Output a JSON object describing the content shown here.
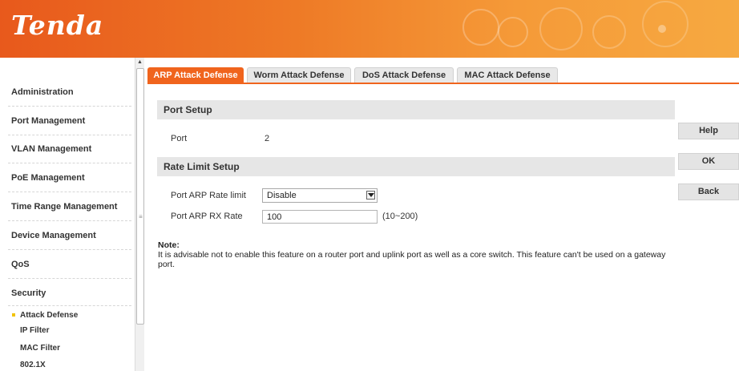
{
  "header": {
    "logo": "Tenda"
  },
  "sidebar": {
    "items": [
      {
        "label": "Administration"
      },
      {
        "label": "Port Management"
      },
      {
        "label": "VLAN Management"
      },
      {
        "label": "PoE Management"
      },
      {
        "label": "Time Range Management"
      },
      {
        "label": "Device Management"
      },
      {
        "label": "QoS"
      },
      {
        "label": "Security"
      }
    ],
    "subitems": [
      {
        "label": "Attack Defense",
        "active": true
      },
      {
        "label": "IP Filter"
      },
      {
        "label": "MAC Filter"
      },
      {
        "label": "802.1X"
      }
    ]
  },
  "tabs": [
    {
      "label": "ARP Attack Defense",
      "active": true
    },
    {
      "label": "Worm Attack Defense"
    },
    {
      "label": "DoS Attack Defense"
    },
    {
      "label": "MAC Attack Defense"
    }
  ],
  "port_setup": {
    "title": "Port Setup",
    "port_label": "Port",
    "port_value": "2"
  },
  "rate_limit": {
    "title": "Rate Limit Setup",
    "limit_label": "Port ARP Rate limit",
    "limit_value": "Disable",
    "rx_label": "Port ARP RX Rate",
    "rx_value": "100",
    "rx_range": "(10~200)"
  },
  "note": {
    "title": "Note:",
    "text": "It is advisable not to enable this feature on a router port and uplink port as well as a core switch. This feature can't be used on a gateway port."
  },
  "buttons": {
    "help": "Help",
    "ok": "OK",
    "back": "Back"
  },
  "colors": {
    "accent": "#f0641d",
    "header_start": "#e8591c",
    "header_end": "#f6a941"
  }
}
